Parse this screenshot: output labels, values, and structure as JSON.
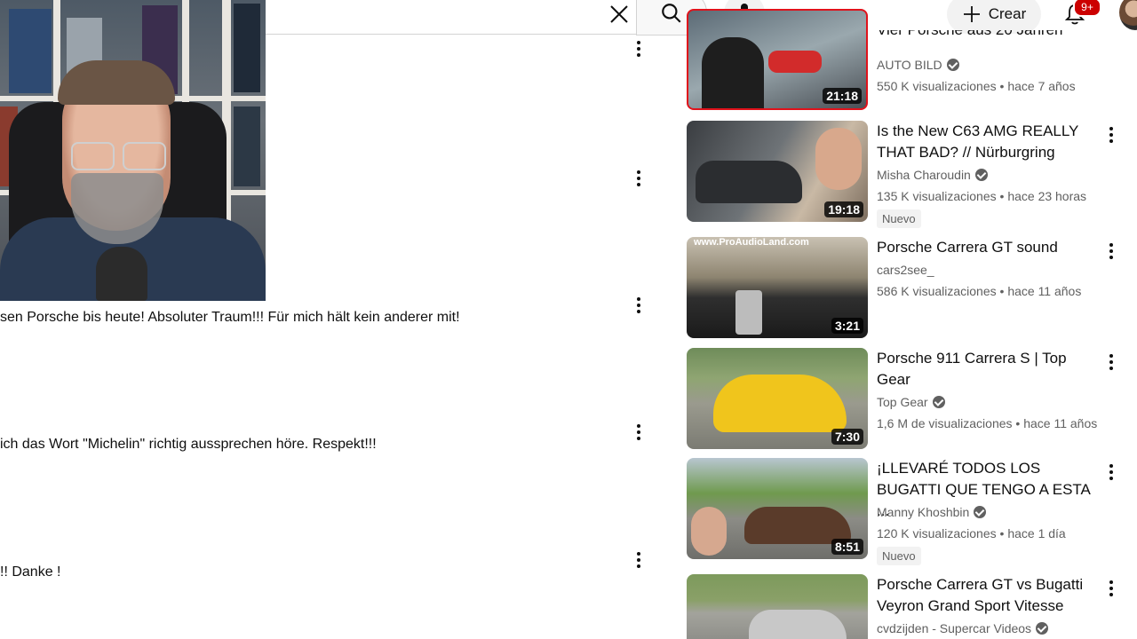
{
  "header": {
    "create_label": "Crear",
    "notifications_count": "9+",
    "icons": {
      "clear": "close-icon",
      "search": "search-icon",
      "mic": "mic-icon",
      "create": "plus-icon",
      "bell": "bell-icon"
    }
  },
  "comments": [
    {
      "text": "sen Porsche bis heute! Absoluter Traum!!! Für mich hält kein anderer mit!"
    },
    {
      "text": " ich das Wort \"Michelin\" richtig aussprechen höre. Respekt!!!"
    },
    {
      "text": "!! Danke !"
    }
  ],
  "related": [
    {
      "title": "Vier Porsche aus 20 Jahren",
      "channel": "AUTO BILD",
      "verified": true,
      "meta": "550 K visualizaciones • hace 7 años",
      "duration": "21:18"
    },
    {
      "title": "Is the New C63 AMG REALLY THAT BAD? // Nürburgring",
      "channel": "Misha Charoudin",
      "verified": true,
      "meta": "135 K visualizaciones • hace 23 horas",
      "badge": "Nuevo",
      "duration": "19:18"
    },
    {
      "title": "Porsche Carrera GT sound",
      "channel": "cars2see_",
      "verified": false,
      "meta": "586 K visualizaciones • hace 11 años",
      "duration": "3:21",
      "thumb_text": "www.ProAudioLand.com"
    },
    {
      "title": "Porsche 911 Carrera S | Top Gear",
      "channel": "Top Gear",
      "verified": true,
      "meta": "1,6 M de visualizaciones • hace 11 años",
      "duration": "7:30"
    },
    {
      "title": "¡LLEVARÉ TODOS LOS BUGATTI QUE TENGO A ESTA ...",
      "channel": "Manny Khoshbin",
      "verified": true,
      "meta": "120 K visualizaciones • hace 1 día",
      "badge": "Nuevo",
      "duration": "8:51"
    },
    {
      "title": "Porsche Carrera GT vs Bugatti Veyron Grand Sport Vitesse",
      "channel": "cvdzijden - Supercar Videos",
      "verified": true
    }
  ],
  "colors": {
    "accent_red": "#cc0000",
    "text": "#0f0f0f",
    "secondary": "#606060"
  }
}
